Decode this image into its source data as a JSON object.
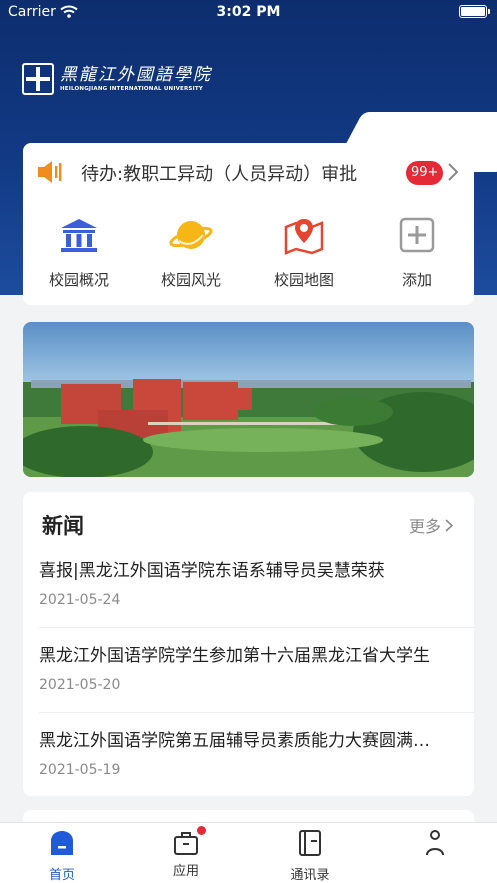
{
  "status_bar": {
    "carrier": "Carrier",
    "time": "3:02 PM"
  },
  "header": {
    "logo_cn": "黑龍江外國語學院",
    "logo_en": "HEILONGJIANG INTERNATIONAL UNIVERSITY",
    "colors": {
      "top": "#0d2d6e",
      "bottom": "#1d4c9e"
    }
  },
  "todo": {
    "text": "待办:教职工异动（人员异动）审批",
    "badge": "99+"
  },
  "quick_items": [
    {
      "label": "校园概况",
      "icon": "building-icon"
    },
    {
      "label": "校园风光",
      "icon": "planet-icon"
    },
    {
      "label": "校园地图",
      "icon": "map-icon"
    },
    {
      "label": "添加",
      "icon": "add-icon"
    }
  ],
  "news": {
    "title": "新闻",
    "more": "更多",
    "items": [
      {
        "headline": "喜报|黑龙江外国语学院东语系辅导员吴慧荣获",
        "date": "2021-05-24"
      },
      {
        "headline": "黑龙江外国语学院学生参加第十六届黑龙江省大学生",
        "date": "2021-05-20"
      },
      {
        "headline": "黑龙江外国语学院第五届辅导员素质能力大赛圆满落幕",
        "date": "2021-05-19"
      }
    ]
  },
  "tabbar": [
    {
      "label": "首页",
      "icon": "home-icon",
      "active": true
    },
    {
      "label": "应用",
      "icon": "briefcase-icon",
      "active": false
    },
    {
      "label": "通讯录",
      "icon": "contacts-icon",
      "active": false
    }
  ],
  "colors": {
    "accent": "#1f5bd6",
    "badge": "#e32a36",
    "icon_orange": "#f28c1c"
  }
}
